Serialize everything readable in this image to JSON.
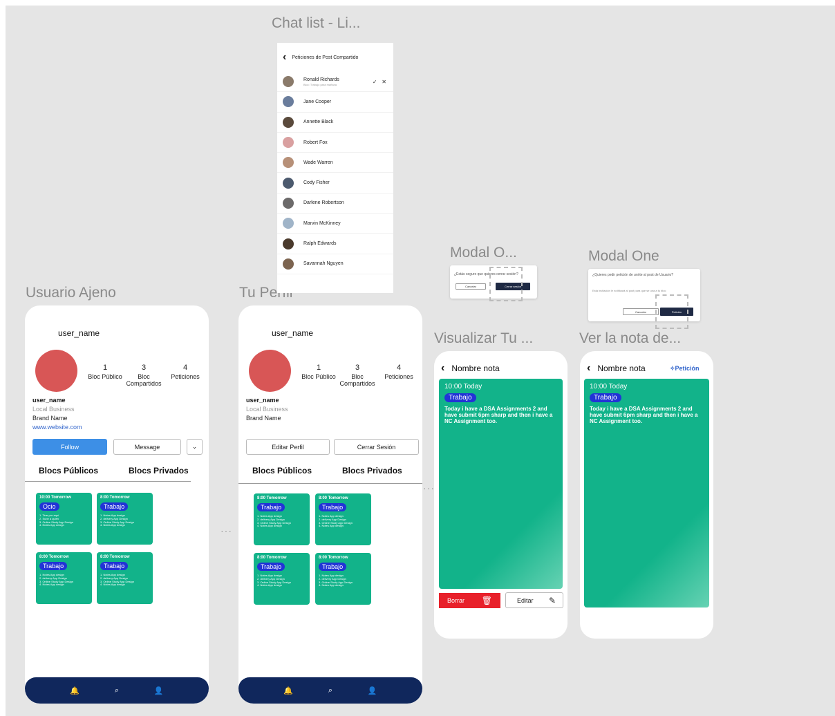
{
  "frames": {
    "chat_list_title": "Chat list - Li...",
    "usuario_ajeno_title": "Usuario Ajeno",
    "tu_perfil_title": "Tu Perfil",
    "modal_o_title": "Modal O...",
    "modal_one_title": "Modal One",
    "visualizar_title": "Visualizar Tu ...",
    "ver_nota_title": "Ver la nota de..."
  },
  "chat_list": {
    "header": "Peticiones de Post Compartido",
    "first": {
      "name": "Ronald Richards",
      "sub": "Bloc: Trabajo para mañana"
    },
    "contacts": [
      "Jane Cooper",
      "Annette Black",
      "Robert Fox",
      "Wade Warren",
      "Cody Fisher",
      "Darlene Robertson",
      "Marvin McKinney",
      "Ralph Edwards",
      "Savannah Nguyen"
    ],
    "avatar_colors": [
      "#8a7a6a",
      "#6a7d9c",
      "#5a4a3c",
      "#d9a0a0",
      "#b79078",
      "#4c5a6e",
      "#6c6a6a",
      "#a0b4c8",
      "#4a3a2c",
      "#7c6450"
    ],
    "accept_icon": "✓",
    "reject_icon": "✕"
  },
  "modal_o": {
    "question": "¿Estás seguro que quieres cerrar sesión?",
    "cancel": "Cancelar",
    "confirm": "Cerrar sesión"
  },
  "modal_one": {
    "question": "¿Quieres pedir petición de unirte al post de Usuario?",
    "body": "Esta invitación le notificará al post para que se una a tu bloc",
    "cancel": "Cancelar",
    "confirm": "Petición"
  },
  "usuario_ajeno": {
    "top_name": "user_name",
    "stats": [
      {
        "n": "1",
        "label": "Bloc Público"
      },
      {
        "n": "3",
        "label": "Bloc Compartidos"
      },
      {
        "n": "4",
        "label": "Peticiones"
      }
    ],
    "name": "user_name",
    "category": "Local Business",
    "brand": "Brand Name",
    "website": "www.website.com",
    "follow": "Follow",
    "message": "Message",
    "tab_public": "Blocs Públicos",
    "tab_private": "Blocs Privados",
    "cards": [
      {
        "time": "10:00 Tomorrow",
        "tag": "Ocio",
        "list": [
          "1. Tirar por aquí",
          "2. Subir a quién",
          "3. Online Study App Design",
          "4. Notes App design"
        ]
      },
      {
        "time": "8:00 Tomorrow",
        "tag": "Trabajo",
        "list": [
          "1. Notes App design",
          "2. delivery App Design",
          "3. Online Study App Design",
          "4. Notes App design"
        ]
      },
      {
        "time": "8:00 Tomorrow",
        "tag": "Trabajo",
        "list": [
          "1. Notes App design",
          "2. delivery App Design",
          "3. Online Study App Design",
          "4. Notes App design"
        ]
      },
      {
        "time": "8:00 Tomorrow",
        "tag": "Trabajo",
        "list": [
          "1. Notes App design",
          "2. delivery App Design",
          "3. Online Study App Design",
          "4. Notes App design"
        ]
      }
    ]
  },
  "tu_perfil": {
    "top_name": "user_name",
    "stats": [
      {
        "n": "1",
        "label": "Bloc Público"
      },
      {
        "n": "3",
        "label": "Bloc Compartidos"
      },
      {
        "n": "4",
        "label": "Peticiones"
      }
    ],
    "name": "user_name",
    "category": "Local Business",
    "brand": "Brand Name",
    "edit": "Editar Perfil",
    "logout": "Cerrar Sesión",
    "tab_public": "Blocs Públicos",
    "tab_private": "Blocs Privados",
    "cards": [
      {
        "time": "8:00 Tomorrow",
        "tag": "Trabajo",
        "list": [
          "1. Notes App design",
          "2. delivery App Design",
          "3. Online Study App Design",
          "4. Notes App design"
        ]
      },
      {
        "time": "8:00 Tomorrow",
        "tag": "Trabajo",
        "list": [
          "1. Notes App design",
          "2. delivery App Design",
          "3. Online Study App Design",
          "4. Notes App design"
        ]
      },
      {
        "time": "8:00 Tomorrow",
        "tag": "Trabajo",
        "list": [
          "1. Notes App design",
          "2. delivery App Design",
          "3. Online Study App Design",
          "4. Notes App design"
        ]
      },
      {
        "time": "8:00 Tomorrow",
        "tag": "Trabajo",
        "list": [
          "1. Notes App design",
          "2. delivery App Design",
          "3. Online Study App Design",
          "4. Notes App design"
        ]
      }
    ]
  },
  "nav": {
    "icons": [
      "bell-icon",
      "search-icon",
      "user-icon"
    ]
  },
  "visualizar": {
    "title": "Nombre nota",
    "time": "10:00 Today",
    "tag": "Trabajo",
    "text": "Today i have a DSA Assignments 2 and have submit 6pm sharp and then i have a NC Assignment too.",
    "delete": "Borrar",
    "edit": "Editar"
  },
  "ver_nota": {
    "title": "Nombre nota",
    "request": "Petición",
    "time": "10:00 Today",
    "tag": "Trabajo",
    "text": "Today i have a DSA Assignments 2 and have submit 6pm sharp and then i have a NC Assignment too."
  },
  "colors": {
    "canvas": "#e5e5e5",
    "green": "#12b38a",
    "tag_blue": "#2233d6",
    "navy": "#10275c",
    "avatar_red": "#d85656",
    "delete_red": "#e8202a",
    "follow_blue": "#3d8fe6"
  }
}
